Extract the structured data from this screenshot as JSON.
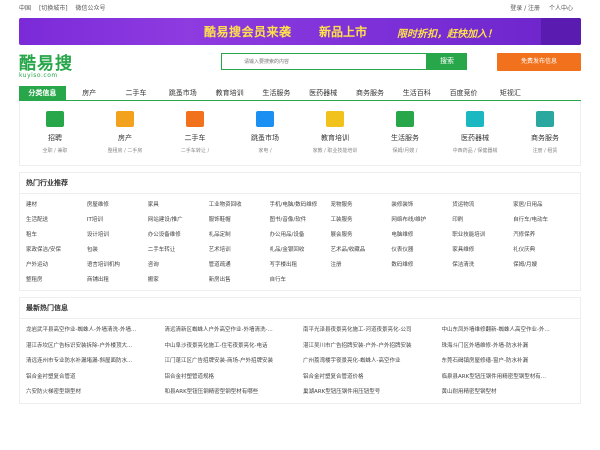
{
  "topbar": {
    "city": "中国",
    "switch_city": "[切换城市]",
    "wechat": "微信公众号",
    "login": "登录 / 注册",
    "user_center": "个人中心"
  },
  "banner": {
    "text1": "酷易搜会员来袭",
    "text2": "新品上市",
    "text3": "限时折扣，赶快加入！"
  },
  "header": {
    "logo_text": "酷易搜",
    "logo_domain": "kuyiso.com",
    "search_placeholder": "请输入要搜索的内容",
    "search_button": "搜索",
    "post_button": "免费发布信息"
  },
  "nav": [
    "分类信息",
    "房产",
    "二手车",
    "跳蚤市场",
    "教育培训",
    "生活服务",
    "医药器械",
    "商务服务",
    "生活百科",
    "百度竞价",
    "矩视汇"
  ],
  "categories": [
    {
      "name": "招聘",
      "sub": "全职 / 兼职",
      "color": "#27a64a"
    },
    {
      "name": "房产",
      "sub": "整租房 / 二手房",
      "color": "#f2a21c"
    },
    {
      "name": "二手车",
      "sub": "二手车转让 /",
      "color": "#f2711c"
    },
    {
      "name": "跳蚤市场",
      "sub": "家电 /",
      "color": "#1c8ff2"
    },
    {
      "name": "教育培训",
      "sub": "家教 / 职业技能培训",
      "color": "#f2c21c"
    },
    {
      "name": "生活服务",
      "sub": "保姆/月嫂 /",
      "color": "#27a64a"
    },
    {
      "name": "医药器械",
      "sub": "中西药品 / 保健器械",
      "color": "#1cb8c2"
    },
    {
      "name": "商务服务",
      "sub": "注册 / 租赁",
      "color": "#2aa8a0"
    }
  ],
  "industry": {
    "title": "热门行业推荐",
    "items": [
      "建材",
      "房屋维修",
      "家具",
      "工业物资回收",
      "手机/电脑/数码维修",
      "宠物服务",
      "装修装饰",
      "货运物流",
      "家居/日用品",
      "生活配送",
      "IT培训",
      "网站建设/推广",
      "服饰鞋帽",
      "图书/音像/软件",
      "工装服务",
      "网络布线/维护",
      "印刷",
      "自行车/电动车",
      "租车",
      "设计培训",
      "办公设备维修",
      "礼品定制",
      "办公用品/设备",
      "展会服务",
      "电脑维修",
      "职业技能培训",
      "汽修保养",
      "家政保洁/安保",
      "包装",
      "二手车转让",
      "艺术培训",
      "礼品/金银回收",
      "艺术品/收藏品",
      "仪表仪器",
      "家具维修",
      "礼仪庆典",
      "户外运动",
      "语言培训机构",
      "咨询",
      "管道疏通",
      "写字楼出租",
      "注册",
      "数码维修",
      "保洁清洗",
      "保姆/月嫂",
      "整租房",
      "商铺出租",
      "搬家",
      "新房出售",
      "自行车"
    ]
  },
  "news": {
    "title": "最新热门信息",
    "items": [
      "龙岩武平县高空作业-蜘蛛人-外墙清洗-外墙...",
      "清远清新区蜘蛛人户外高空作业-外墙清洗-...",
      "南平光泽县夜景亮化施工-河道夜景亮化-公司",
      "中山东凤外墙维修翻新-蜘蛛人高空作业-外...",
      "湛江赤坎区广告标识安装拆除-户外楼顶大...",
      "中山阜沙夜景亮化施工-住宅夜景亮化-电话",
      "湛江吴川市广告招牌安装-户外-户外招牌安装",
      "珠海斗门区外墙维修-外墙-防水补漏",
      "清远连州市专业防水补漏堵漏-斜屋面防水...",
      "江门蓬江区广告招牌安装-商场-户外招牌安装",
      "广州荔湾楼宇夜景亮化-蜘蛛人-高空作业",
      "东莞石碣镇房屋修缮-窗户-防水补漏",
      "铝合金衬塑复合管道",
      "铝合金衬塑管道规格",
      "铝合金衬塑复合管道价格",
      "临泉县ARK型钮压钢件用精密型钢型材有...",
      "六安防火梯密型钢型材",
      "和县ARK型钮压钢精密型钢型材有哪些",
      "巢湖ARK型钮压钢件用压钮型号",
      "黄山耐用精密型钢型材"
    ]
  }
}
